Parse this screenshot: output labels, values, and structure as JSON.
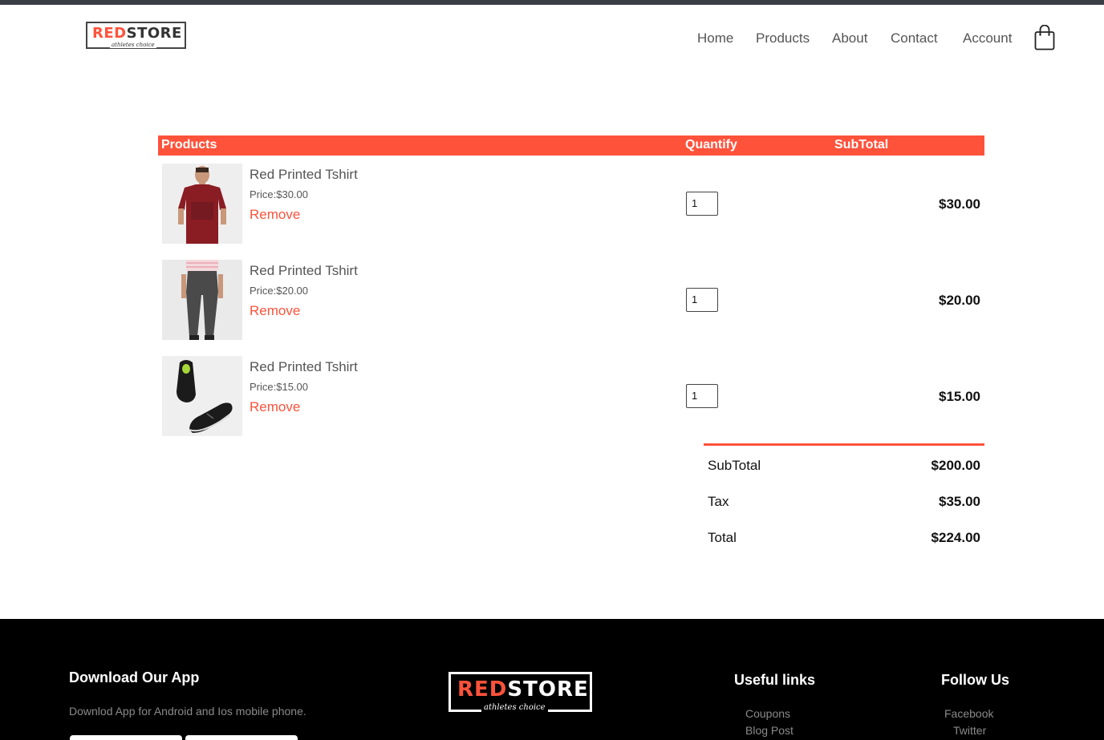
{
  "brand": {
    "name_part1": "RED",
    "name_part2": "STORE",
    "tagline": "athletes choice"
  },
  "nav": {
    "items": [
      "Home",
      "Products",
      "About",
      "Contact",
      "Account"
    ],
    "cart_icon": "shopping-bag-icon"
  },
  "cart": {
    "headers": {
      "products": "Products",
      "quantity": "Quantify",
      "subtotal": "SubTotal"
    },
    "items": [
      {
        "name": "Red Printed Tshirt",
        "price": "Price:$30.00",
        "remove": "Remove",
        "quantity": "1",
        "subtotal": "$30.00",
        "image": "red-tshirt-man-image"
      },
      {
        "name": "Red Printed Tshirt",
        "price": "Price:$20.00",
        "remove": "Remove",
        "quantity": "1",
        "subtotal": "$20.00",
        "image": "grey-trousers-image"
      },
      {
        "name": "Red Printed Tshirt",
        "price": "Price:$15.00",
        "remove": "Remove",
        "quantity": "1",
        "subtotal": "$15.00",
        "image": "black-sneakers-image"
      }
    ],
    "totals": [
      {
        "label": "SubTotal",
        "value": "$200.00"
      },
      {
        "label": "Tax",
        "value": "$35.00"
      },
      {
        "label": "Total",
        "value": "$224.00"
      }
    ]
  },
  "footer": {
    "download_title": "Download Our App",
    "download_text": "Downlod App for Android and Ios mobile phone.",
    "useful_links_title": "Useful links",
    "useful_links": [
      "Coupons",
      "Blog Post"
    ],
    "follow_title": "Follow Us",
    "follow_links": [
      "Facebook",
      "Twitter"
    ]
  },
  "colors": {
    "accent": "#ff523b",
    "footer_bg": "#000000",
    "topbar": "#3a3d44"
  }
}
